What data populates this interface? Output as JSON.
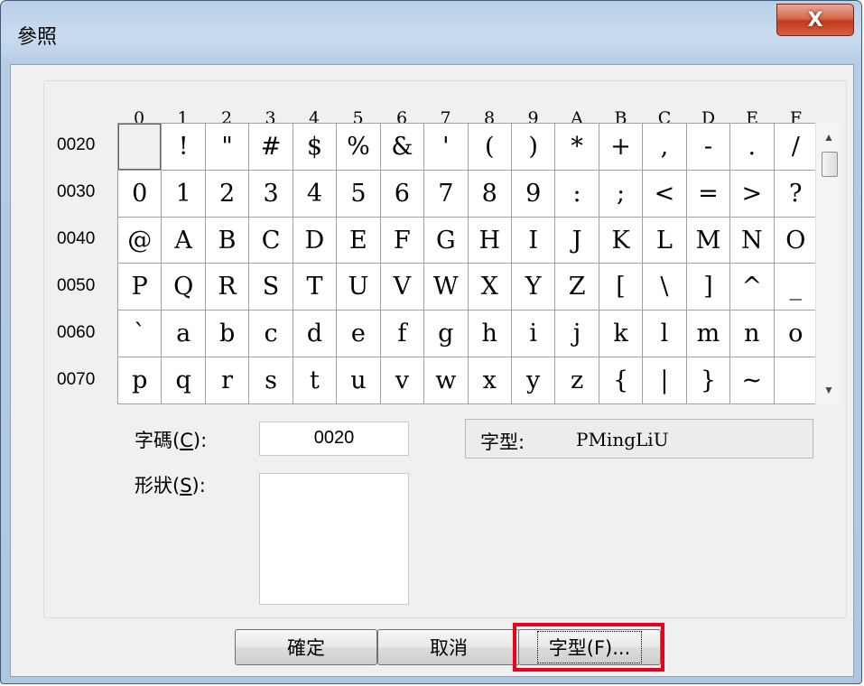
{
  "window": {
    "title": "參照",
    "close_label": "X"
  },
  "grid": {
    "columns": [
      "0",
      "1",
      "2",
      "3",
      "4",
      "5",
      "6",
      "7",
      "8",
      "9",
      "A",
      "B",
      "C",
      "D",
      "E",
      "F"
    ],
    "rows": [
      {
        "code": "0020",
        "chars": [
          "",
          "!",
          "\"",
          "#",
          "$",
          "%",
          "&",
          "'",
          "(",
          ")",
          "*",
          "+",
          ",",
          "-",
          ".",
          "/"
        ]
      },
      {
        "code": "0030",
        "chars": [
          "0",
          "1",
          "2",
          "3",
          "4",
          "5",
          "6",
          "7",
          "8",
          "9",
          ":",
          ";",
          "<",
          "=",
          ">",
          "?"
        ]
      },
      {
        "code": "0040",
        "chars": [
          "@",
          "A",
          "B",
          "C",
          "D",
          "E",
          "F",
          "G",
          "H",
          "I",
          "J",
          "K",
          "L",
          "M",
          "N",
          "O"
        ]
      },
      {
        "code": "0050",
        "chars": [
          "P",
          "Q",
          "R",
          "S",
          "T",
          "U",
          "V",
          "W",
          "X",
          "Y",
          "Z",
          "[",
          "\\",
          "]",
          "^",
          "_"
        ]
      },
      {
        "code": "0060",
        "chars": [
          "`",
          "a",
          "b",
          "c",
          "d",
          "e",
          "f",
          "g",
          "h",
          "i",
          "j",
          "k",
          "l",
          "m",
          "n",
          "o"
        ]
      },
      {
        "code": "0070",
        "chars": [
          "p",
          "q",
          "r",
          "s",
          "t",
          "u",
          "v",
          "w",
          "x",
          "y",
          "z",
          "{",
          "|",
          "}",
          "~",
          ""
        ]
      }
    ]
  },
  "scrollbar": {
    "up_icon": "▲",
    "down_icon": "▼"
  },
  "fields": {
    "code_label_prefix": "字碼(",
    "code_label_key": "C",
    "code_label_suffix": "):",
    "code_value": "0020",
    "shape_label_prefix": "形狀(",
    "shape_label_key": "S",
    "shape_label_suffix": "):",
    "font_label": "字型:",
    "font_value": "PMingLiU"
  },
  "buttons": {
    "ok": "確定",
    "cancel": "取消",
    "font": "字型(F)..."
  },
  "colors": {
    "highlight": "#e8001c"
  }
}
